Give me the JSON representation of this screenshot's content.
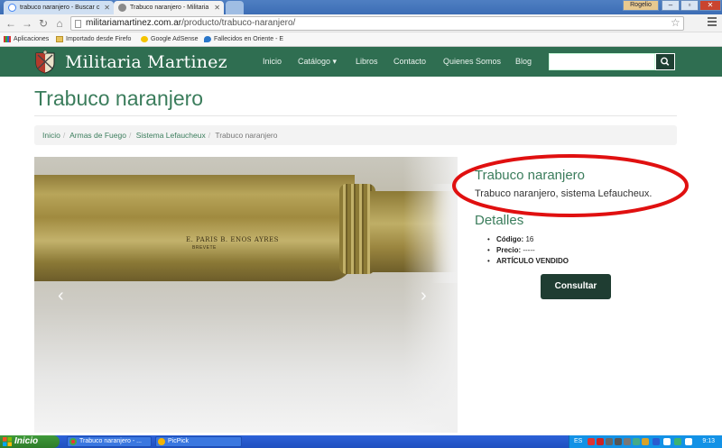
{
  "browser": {
    "tabs": [
      {
        "label": "trabuco naranjero - Buscar c"
      },
      {
        "label": "Trabuco naranjero - Militaria"
      }
    ],
    "window_user": "Rogelio",
    "url_domain": "militariamartinez.com.ar",
    "url_path": "/producto/trabuco-naranjero/",
    "bookmarks": [
      {
        "label": "Aplicaciones"
      },
      {
        "label": "Importado desde Firefo"
      },
      {
        "label": "Google AdSense"
      },
      {
        "label": "Fallecidos en Oriente - E"
      }
    ]
  },
  "site": {
    "logo_text": "Militaria Martinez",
    "nav": [
      {
        "label": "Inicio"
      },
      {
        "label": "Catálogo ▾"
      },
      {
        "label": "Libros"
      },
      {
        "label": "Contacto"
      },
      {
        "label": "Quienes Somos"
      },
      {
        "label": "Blog"
      }
    ],
    "search_placeholder": ""
  },
  "page": {
    "title": "Trabuco naranjero",
    "breadcrumb": [
      "Inicio",
      "Armas de Fuego",
      "Sistema Lefaucheux",
      "Trabuco naranjero"
    ],
    "image_marking_1": "E. PARIS  B. ENOS AYRES",
    "image_marking_2": "BREVETE"
  },
  "product": {
    "title": "Trabuco naranjero",
    "subtitle": "Trabuco naranjero, sistema Lefaucheux.",
    "details_heading": "Detalles",
    "details": [
      {
        "label": "Código:",
        "value": " 16"
      },
      {
        "label": "Precio:",
        "value": " -----"
      },
      {
        "label": "ARTÍCULO VENDIDO",
        "value": ""
      }
    ],
    "consult_label": "Consultar"
  },
  "taskbar": {
    "start_label": "Inicio",
    "tasks": [
      {
        "label": "Trabuco naranjero - ..."
      },
      {
        "label": "PicPick"
      }
    ],
    "lang": "ES",
    "time": "9:13"
  },
  "colors": {
    "brand_green": "#2f6e51",
    "accent_green": "#3b7d5c",
    "annotation_red": "#e01010"
  }
}
